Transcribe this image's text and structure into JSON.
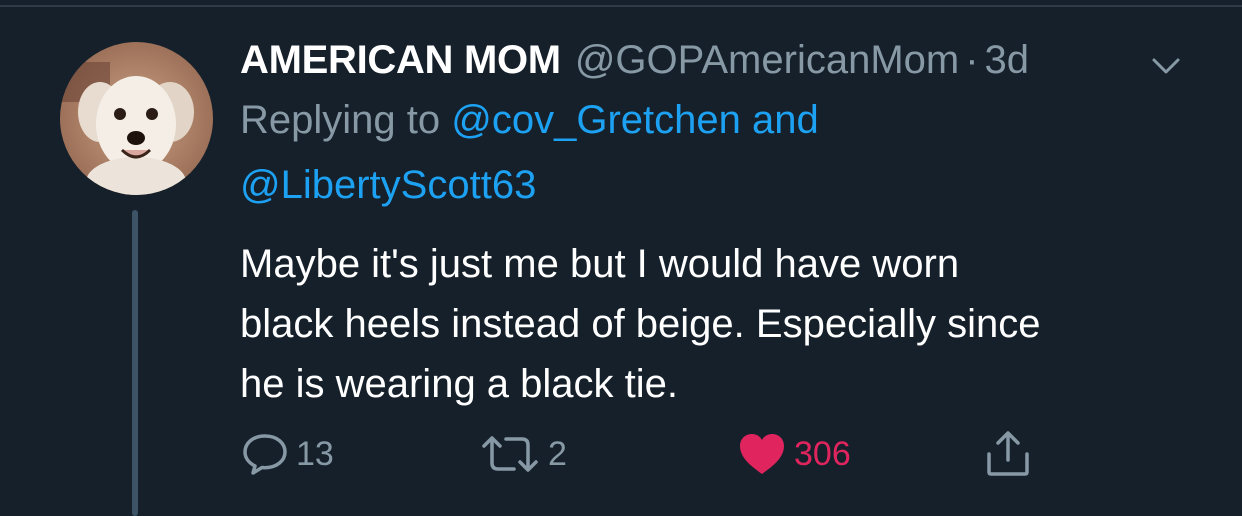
{
  "tweet": {
    "display_name": "AMERICAN MOM",
    "handle": "@GOPAmericanMom",
    "dot": "·",
    "time": "3d",
    "replying_prefix": "Replying to",
    "reply_mention_1": "@cov_Gretchen",
    "reply_joiner": "and",
    "reply_mention_2": "@LibertyScott63",
    "text_lines": [
      "Maybe it's just me but I would have worn",
      "black heels instead of beige. Especially since",
      "he is wearing a black tie."
    ]
  },
  "actions": {
    "replies": "13",
    "retweets": "2",
    "likes": "306"
  },
  "icons": {
    "reply": "speech-bubble-icon",
    "retweet": "retweet-icon",
    "like": "heart-icon",
    "share": "share-icon",
    "menu": "chevron-down-icon"
  },
  "colors": {
    "background": "#15202b",
    "muted": "#8899a6",
    "link": "#1da1f2",
    "like": "#e0245e"
  }
}
